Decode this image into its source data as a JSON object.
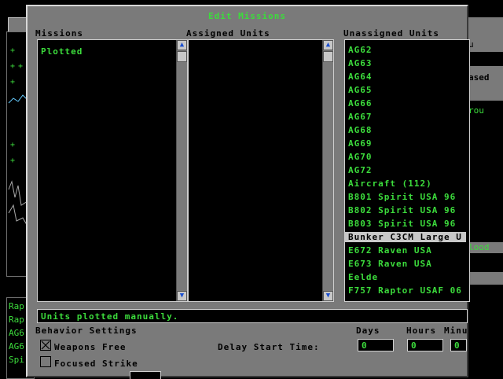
{
  "dialog": {
    "title": "Edit Missions",
    "missions_header": "Missions",
    "assigned_header": "Assigned Units",
    "unassigned_header": "Unassigned Units",
    "missions": [
      "Plotted"
    ],
    "unassigned_units": [
      "AG62",
      "AG63",
      "AG64",
      "AG65",
      "AG66",
      "AG67",
      "AG68",
      "AG69",
      "AG70",
      "AG72",
      "Aircraft (112)",
      "B801 Spirit USA 96",
      "B802 Spirit USA 96",
      "B803 Spirit USA 96",
      "Bunker C3CM Large U",
      "E672 Raven USA",
      "E673 Raven USA",
      "Eelde",
      "F757 Raptor USAF 06"
    ],
    "selected_unassigned_index": 14,
    "status_text": "Units plotted manually.",
    "behavior_header": "Behavior Settings",
    "weapons_free_label": "Weapons Free",
    "weapons_free_checked": true,
    "focused_strike_label": "Focused Strike",
    "focused_strike_checked": false,
    "delay_label": "Delay Start Time:",
    "days_label": "Days",
    "hours_label": "Hours",
    "minutes_label": "Minu",
    "days_value": "0",
    "hours_value": "0",
    "minutes_value": "0"
  },
  "background": {
    "left_units": [
      "Rap",
      "Rap",
      "AG6",
      "AG6",
      "Spi"
    ],
    "right_texts": [
      "u",
      "ased",
      "rou",
      "lood"
    ]
  },
  "colors": {
    "panel": "#7a7a7a",
    "list_bg": "#000000",
    "list_text": "#3cdc3c",
    "selected_bg": "#c8c8c8",
    "arrow": "#1a4fd0"
  },
  "icons": [
    "zoom-in-icon",
    "scroll-up-arrow-icon",
    "scroll-down-arrow-icon",
    "checkbox-x-icon"
  ]
}
